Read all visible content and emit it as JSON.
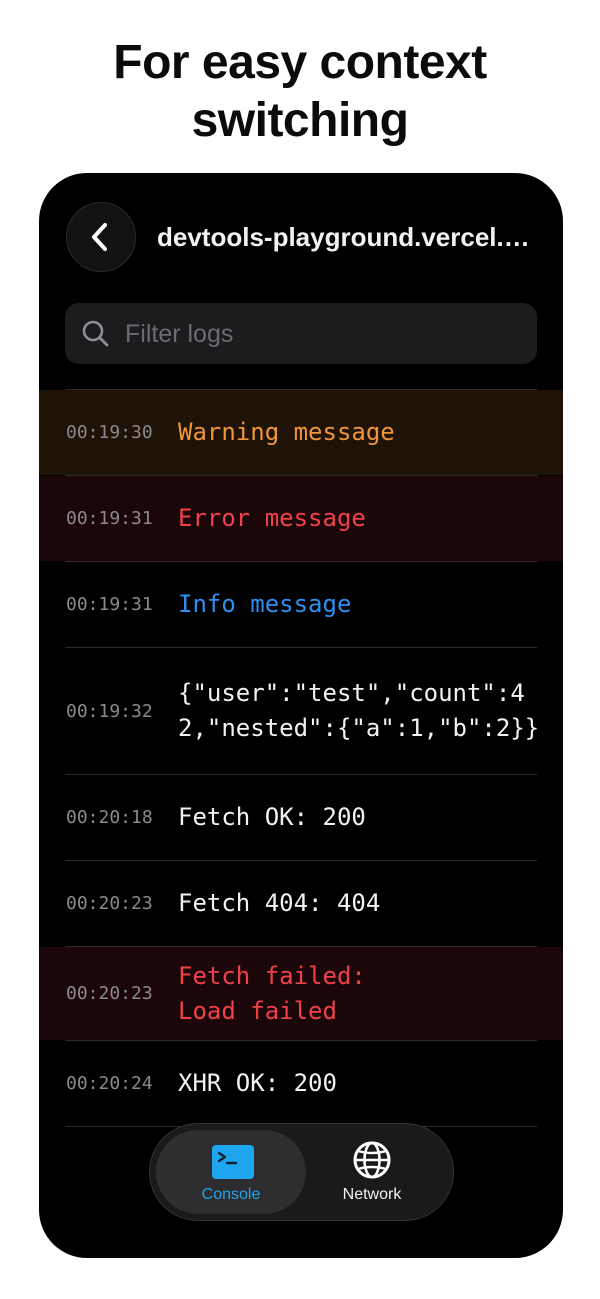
{
  "headline": [
    "For easy context",
    "switching"
  ],
  "header": {
    "back_icon": "chevron-left-icon",
    "title": "devtools-playground.vercel.app"
  },
  "search": {
    "placeholder": "Filter logs",
    "value": "",
    "icon": "search-icon"
  },
  "colors": {
    "warning": "#f0953a",
    "error": "#f0404a",
    "info": "#2f8ff0",
    "accent": "#1ea7f0"
  },
  "logs": [
    {
      "time": "00:19:30",
      "message": "Warning message",
      "level": "warning"
    },
    {
      "time": "00:19:31",
      "message": "Error message",
      "level": "error"
    },
    {
      "time": "00:19:31",
      "message": "Info message",
      "level": "info"
    },
    {
      "time": "00:19:32",
      "message": "{\"user\":\"test\",\"count\":42,\"nested\":{\"a\":1,\"b\":2}}",
      "level": "log"
    },
    {
      "time": "00:20:18",
      "message": "Fetch OK: 200",
      "level": "log"
    },
    {
      "time": "00:20:23",
      "message": "Fetch 404: 404",
      "level": "log"
    },
    {
      "time": "00:20:23",
      "message": "Fetch failed:\nLoad failed",
      "level": "error"
    },
    {
      "time": "00:20:24",
      "message": "XHR OK: 200",
      "level": "log"
    }
  ],
  "tabs": [
    {
      "label": "Console",
      "icon": "terminal-icon",
      "active": true
    },
    {
      "label": "Network",
      "icon": "globe-icon",
      "active": false
    }
  ]
}
